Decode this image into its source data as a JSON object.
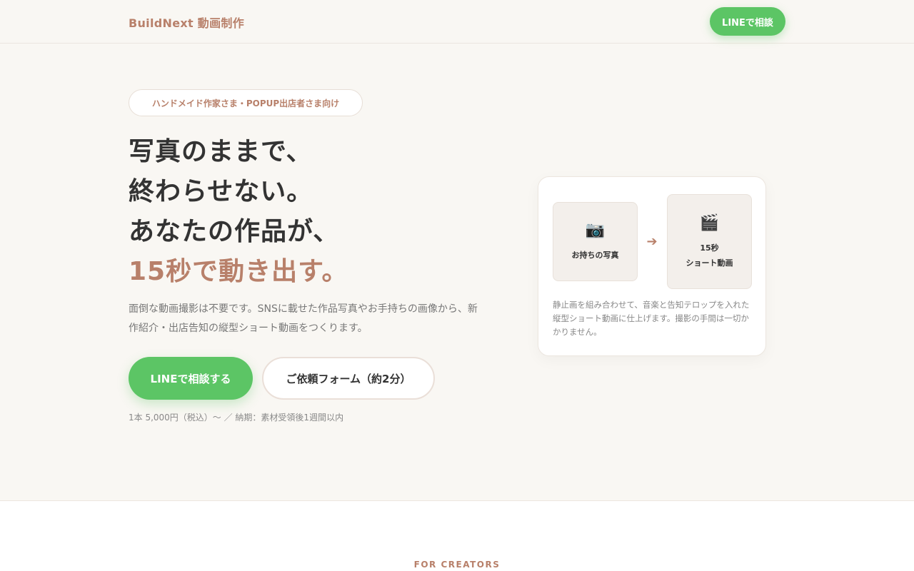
{
  "header": {
    "brand": "BuildNext 動画制作",
    "cta_label": "LINEで相談"
  },
  "hero": {
    "badge": "ハンドメイド作家さま・POPUP出店者さま向け",
    "title_lines": [
      "写真のままで、",
      "終わらせない。",
      "あなたの作品が、"
    ],
    "title_accent": "15秒で動き出す。",
    "lead": "面倒な動画撮影は不要です。SNSに載せた作品写真やお手持ちの画像から、新作紹介・出店告知の縦型ショート動画をつくります。",
    "primary_button": "LINEで相談する",
    "secondary_button": "ご依頼フォーム（約2分）",
    "price_note": "1本 5,000円（税込）〜 ／ 納期：素材受領後1週間以内"
  },
  "card": {
    "before": {
      "icon": "camera-icon",
      "glyph": "📷",
      "label": "お持ちの写真"
    },
    "arrow_glyph": "➔",
    "after": {
      "icon": "clapperboard-icon",
      "glyph": "🎬",
      "label_line1": "15秒",
      "label_line2": "ショート動画"
    },
    "description": "静止画を組み合わせて、音楽と告知テロップを入れた縦型ショート動画に仕上げます。撮影の手間は一切かかりません。"
  },
  "section2": {
    "eyebrow": "FOR CREATORS"
  },
  "colors": {
    "accent": "#b8806a",
    "line_green": "#5cc565",
    "background": "#f9f7f3"
  }
}
